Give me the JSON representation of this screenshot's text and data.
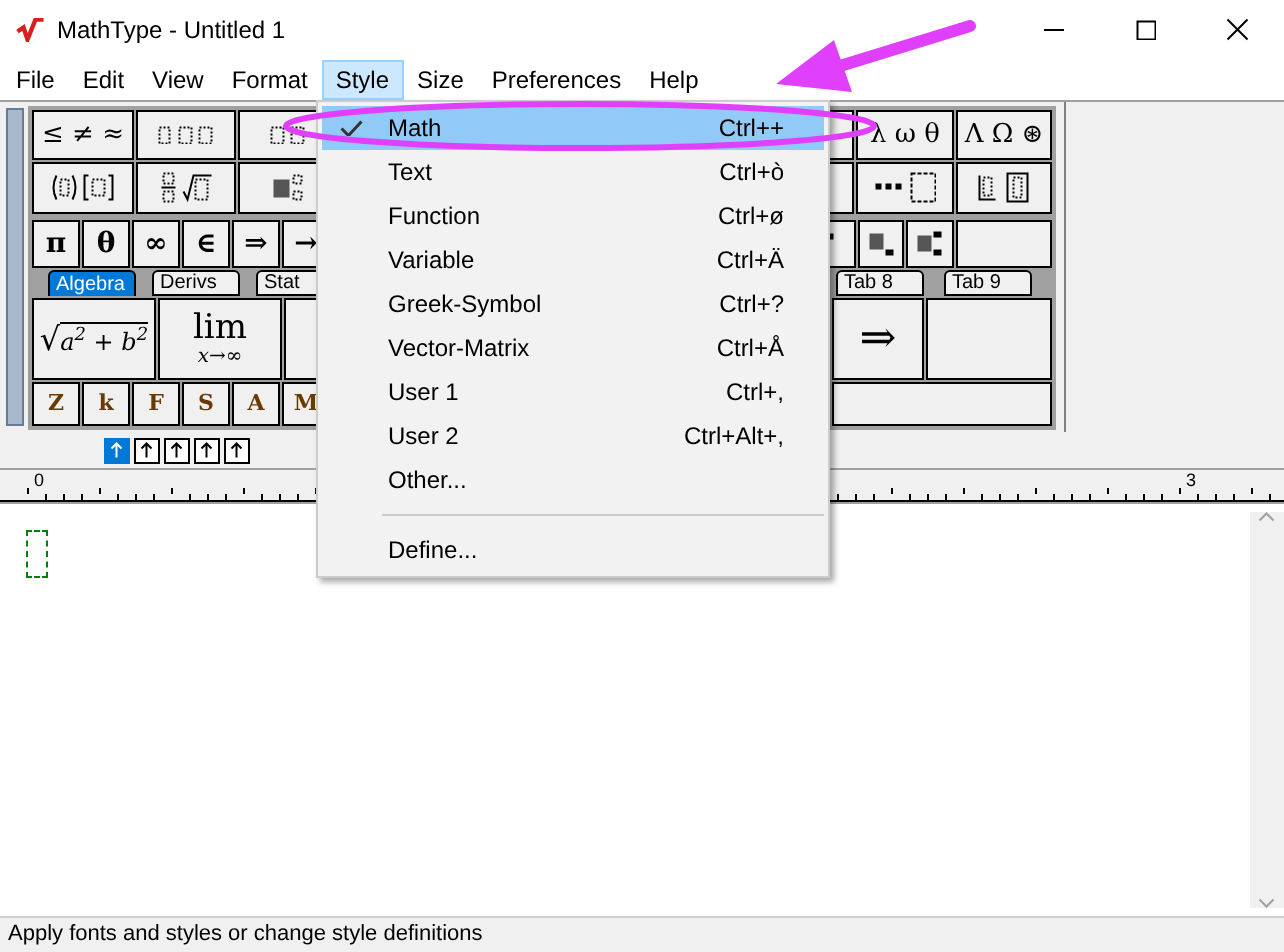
{
  "window": {
    "title": "MathType - Untitled 1"
  },
  "menu_bar": [
    {
      "label": "File",
      "selected": false
    },
    {
      "label": "Edit",
      "selected": false
    },
    {
      "label": "View",
      "selected": false
    },
    {
      "label": "Format",
      "selected": false
    },
    {
      "label": "Style",
      "selected": true
    },
    {
      "label": "Size",
      "selected": false
    },
    {
      "label": "Preferences",
      "selected": false
    },
    {
      "label": "Help",
      "selected": false
    }
  ],
  "style_menu": [
    {
      "label": "Math",
      "shortcut": "Ctrl++",
      "checked": true,
      "selected": true,
      "separator_before": false
    },
    {
      "label": "Text",
      "shortcut": "Ctrl+ò",
      "checked": false,
      "selected": false,
      "separator_before": false
    },
    {
      "label": "Function",
      "shortcut": "Ctrl+ø",
      "checked": false,
      "selected": false,
      "separator_before": false
    },
    {
      "label": "Variable",
      "shortcut": "Ctrl+Ä",
      "checked": false,
      "selected": false,
      "separator_before": false
    },
    {
      "label": "Greek-Symbol",
      "shortcut": "Ctrl+?",
      "checked": false,
      "selected": false,
      "separator_before": false
    },
    {
      "label": "Vector-Matrix",
      "shortcut": "Ctrl+Å",
      "checked": false,
      "selected": false,
      "separator_before": false
    },
    {
      "label": "User 1",
      "shortcut": "Ctrl+,",
      "checked": false,
      "selected": false,
      "separator_before": false
    },
    {
      "label": "User 2",
      "shortcut": "Ctrl+Alt+,",
      "checked": false,
      "selected": false,
      "separator_before": false
    },
    {
      "label": "Other...",
      "checked": false,
      "selected": false,
      "separator_before": false
    },
    {
      "kind": "separator"
    },
    {
      "label": "Define...",
      "checked": false,
      "selected": false,
      "separator_before": false
    }
  ],
  "palette": {
    "relations": "≤ ≠ ≈",
    "greek_lower": "λ ω θ",
    "greek_upper": "Λ Ω ⊛",
    "symbols": [
      "π",
      "θ",
      "∞",
      "∈",
      "⇒",
      "→"
    ],
    "tabs_left": [
      {
        "label": "Algebra",
        "selected": true
      },
      {
        "label": "Derivs",
        "selected": false
      },
      {
        "label": "Stat",
        "selected": false
      }
    ],
    "tabs_right": [
      {
        "label": "Tab 8",
        "selected": false
      },
      {
        "label": "Tab 9",
        "selected": false
      }
    ],
    "radical": {
      "sign": "√",
      "body": "a$^{2}$ + b$^{2}$"
    },
    "limit": {
      "top": "lim",
      "bottom": "x→∞"
    },
    "arrow_button": "⇒",
    "letters": [
      "Z",
      "k",
      "F",
      "S",
      "A",
      "M"
    ]
  },
  "size_buttons": [
    {
      "selected": true
    },
    {
      "selected": false
    },
    {
      "selected": false
    },
    {
      "selected": false
    },
    {
      "selected": false
    }
  ],
  "ruler_labels": [
    "0",
    "3"
  ],
  "status_bar": "Apply fonts and styles or change style definitions"
}
